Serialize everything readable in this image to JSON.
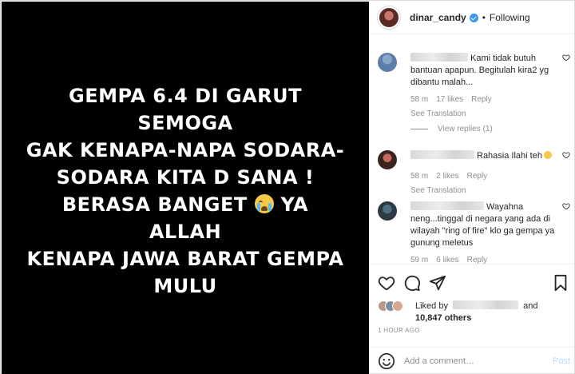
{
  "post": {
    "caption_lines": "GEMPA 6.4 DI GARUT SEMOGA\nGAK KENAPA-NAPA SODARA-\nSODARA KITA D SANA !\nBERASA BANGET",
    "caption_tail_1": " YA ALLAH",
    "caption_tail_2": "KENAPA JAWA BARAT GEMPA\nMULU",
    "emoji": "crying-face-icon",
    "background": "#000000",
    "text_color": "#ffffff"
  },
  "header": {
    "username": "dinar_candy",
    "separator": "•",
    "follow_state": "Following",
    "verified_color": "#3897f0"
  },
  "comments": [
    {
      "text": "Kami tidak butuh bantuan apapun. Begitulah kira2 yg dibantu malah...",
      "time": "58 m",
      "likes": "17 likes",
      "reply": "Reply",
      "see_translation": "See Translation"
    },
    {
      "text": "Rahasia Ilahi teh",
      "time": "58 m",
      "likes": "2 likes",
      "reply": "Reply",
      "see_translation": "See Translation"
    },
    {
      "text": "Wayahna neng...tinggal di negara yang ada di wilayah \"ring of fire\" klo ga gempa ya gunung meletus",
      "time": "59 m",
      "likes": "6 likes",
      "reply": "Reply"
    }
  ],
  "view_replies": "View replies (1)",
  "likes": {
    "prefix": "Liked by",
    "conj": "and",
    "others": "10,847 others"
  },
  "timestamp": "1 HOUR AGO",
  "add_comment": {
    "placeholder": "Add a comment…",
    "post_label": "Post"
  },
  "colors": {
    "border": "#dbdbdb",
    "muted": "#8e8e8e",
    "text": "#262626",
    "post_button": "#b2dffc"
  }
}
